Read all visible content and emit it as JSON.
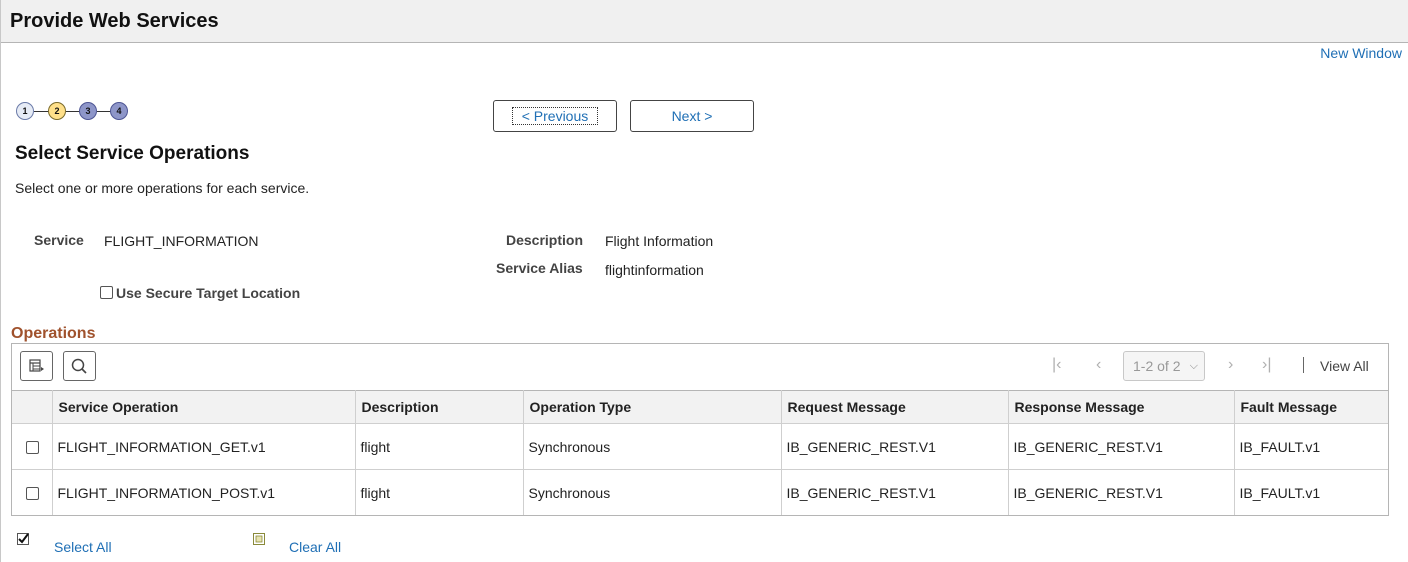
{
  "header": {
    "title": "Provide Web Services"
  },
  "links": {
    "new_window": "New Window"
  },
  "wizard": {
    "steps": [
      {
        "label": "1",
        "state": "done"
      },
      {
        "label": "2",
        "state": "current"
      },
      {
        "label": "3",
        "state": "todo"
      },
      {
        "label": "4",
        "state": "todo"
      }
    ],
    "previous_label": "< Previous",
    "next_label": "Next >"
  },
  "section": {
    "title": "Select Service Operations",
    "instructions": "Select one or more operations for each service."
  },
  "service": {
    "service_label": "Service",
    "service_value": "FLIGHT_INFORMATION",
    "description_label": "Description",
    "description_value": "Flight Information",
    "alias_label": "Service Alias",
    "alias_value": "flightinformation",
    "secure_label": "Use Secure Target Location",
    "secure_checked": false
  },
  "operations": {
    "title": "Operations",
    "pager": {
      "range": "1-2 of 2",
      "view_all": "View All"
    },
    "columns": [
      "Service Operation",
      "Description",
      "Operation Type",
      "Request Message",
      "Response Message",
      "Fault Message"
    ],
    "rows": [
      {
        "checked": false,
        "cells": [
          "FLIGHT_INFORMATION_GET.v1",
          "flight",
          "Synchronous",
          "IB_GENERIC_REST.V1",
          "IB_GENERIC_REST.V1",
          "IB_FAULT.v1"
        ]
      },
      {
        "checked": false,
        "cells": [
          "FLIGHT_INFORMATION_POST.v1",
          "flight",
          "Synchronous",
          "IB_GENERIC_REST.V1",
          "IB_GENERIC_REST.V1",
          "IB_FAULT.v1"
        ]
      }
    ]
  },
  "footer": {
    "select_all": "Select All",
    "clear_all": "Clear All"
  },
  "colors": {
    "link": "#1f6fb5",
    "grid_title": "#a0522d",
    "step_current": "#ffe08a",
    "step_todo": "#8e96c9"
  }
}
